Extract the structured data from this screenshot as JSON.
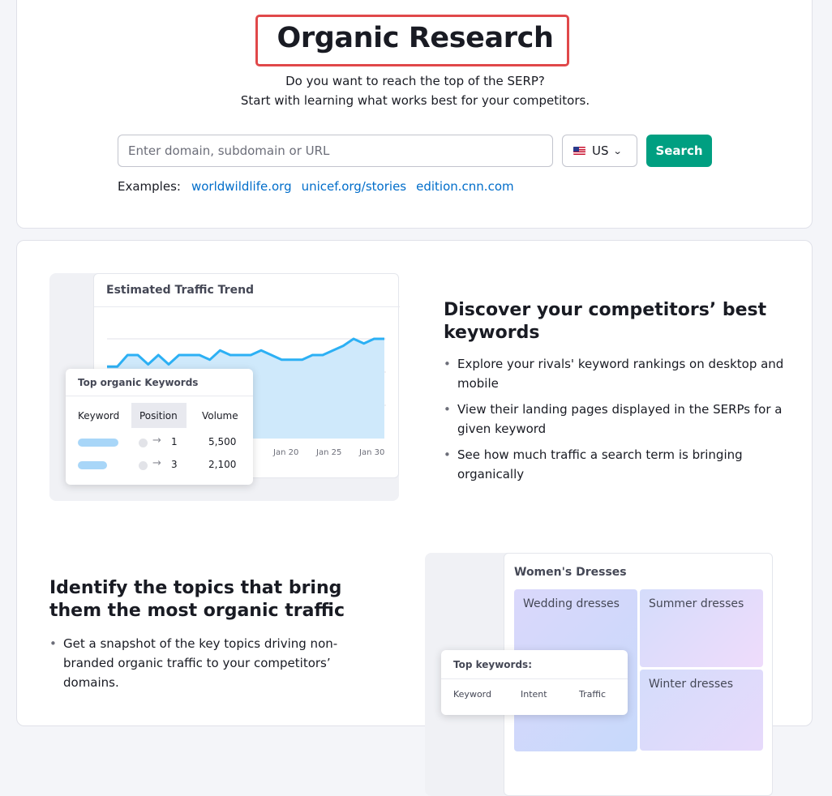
{
  "hero": {
    "title": "Organic Research",
    "subtitle_line1": "Do you want to reach the top of the SERP?",
    "subtitle_line2": "Start with learning what works best for your competitors.",
    "search_placeholder": "Enter domain, subdomain or URL",
    "search_value": "",
    "database": {
      "selected": "US",
      "flag_icon": "us-flag-icon"
    },
    "search_button": "Search",
    "examples_label": "Examples:",
    "examples": [
      "worldwildlife.org",
      "unicef.org/stories",
      "edition.cnn.com"
    ],
    "colors": {
      "accent": "#009f81",
      "link": "#006dca",
      "highlight_frame": "#e0484a"
    }
  },
  "feature1": {
    "heading": "Discover your competitors’ best keywords",
    "bullets": [
      "Explore your rivals' keyword rankings on desktop and mobile",
      "View their landing pages displayed in the SERPs for a given keyword",
      "See how much traffic a search term is bringing organically"
    ],
    "illustration": {
      "title": "Estimated Traffic Trend",
      "x_ticks": [
        "Jan 20",
        "Jan 25",
        "Jan 30"
      ],
      "trend_values": [
        62,
        62,
        72,
        72,
        64,
        72,
        64,
        72,
        72,
        72,
        68,
        76,
        72,
        72,
        72,
        76,
        72,
        68,
        68,
        68,
        72,
        72,
        76,
        80,
        86,
        82,
        86,
        86
      ],
      "keywords_panel": {
        "title": "Top organic Keywords",
        "headers": [
          "Keyword",
          "Position",
          "Volume"
        ],
        "rows": [
          {
            "position": "1",
            "volume": "5,500"
          },
          {
            "position": "3",
            "volume": "2,100"
          }
        ]
      }
    }
  },
  "feature2": {
    "heading": "Identify the topics that bring them the most organic traffic",
    "bullets": [
      "Get a snapshot of the key topics driving non-branded organic traffic to your competitors’ domains."
    ],
    "illustration": {
      "title": "Women's Dresses",
      "tiles": [
        "Wedding dresses",
        "Summer dresses",
        "Winter dresses"
      ],
      "keywords_panel": {
        "title": "Top keywords:",
        "headers": [
          "Keyword",
          "Intent",
          "Traffic"
        ]
      }
    }
  }
}
